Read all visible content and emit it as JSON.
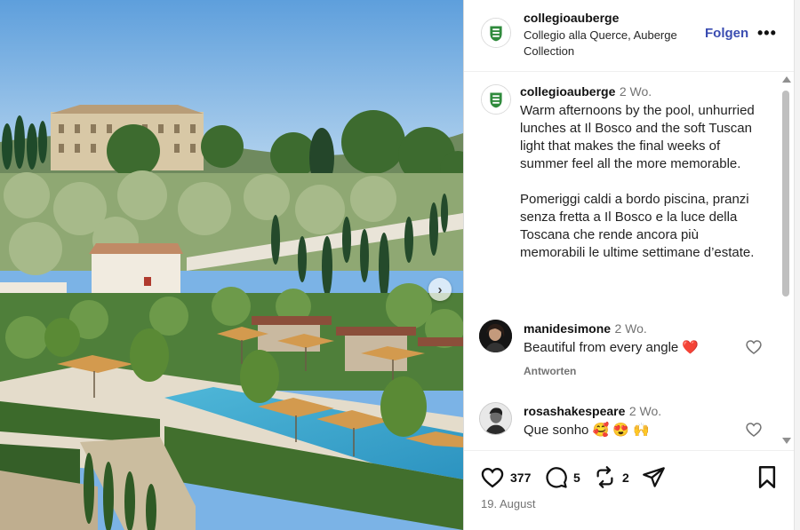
{
  "post": {
    "username": "collegioauberge",
    "location": "Collegio alla Querce, Auberge Collection",
    "follow_label": "Folgen",
    "more_label": "•••",
    "caption_time": "2 Wo.",
    "caption": "Warm afternoons by the pool, unhurried lunches at Il Bosco and the soft Tuscan light that makes the final weeks of summer feel all the more memorable.\n\nPomeriggi caldi a bordo piscina, pranzi senza fretta a Il Bosco e la luce della Toscana che rende ancora più memorabili le ultime settimane d’estate.",
    "date": "19. August"
  },
  "photo": {
    "next_label": "›"
  },
  "comments": [
    {
      "username": "manidesimone",
      "time": "2 Wo.",
      "text": "Beautiful from every angle ❤️",
      "reply_label": "Antworten"
    },
    {
      "username": "rosashakespeare",
      "time": "2 Wo.",
      "text": "Que sonho 🥰 😍 🙌"
    }
  ],
  "actions": {
    "likes": "377",
    "comments": "5",
    "reposts": "2"
  },
  "colors": {
    "follow": "#3a4cb1",
    "brand_green": "#2f8a3c",
    "like_heart": "#e0245e"
  },
  "icons": [
    "heart-icon",
    "comment-icon",
    "repost-icon",
    "share-icon",
    "bookmark-icon",
    "more-icon",
    "chevron-right-icon"
  ]
}
